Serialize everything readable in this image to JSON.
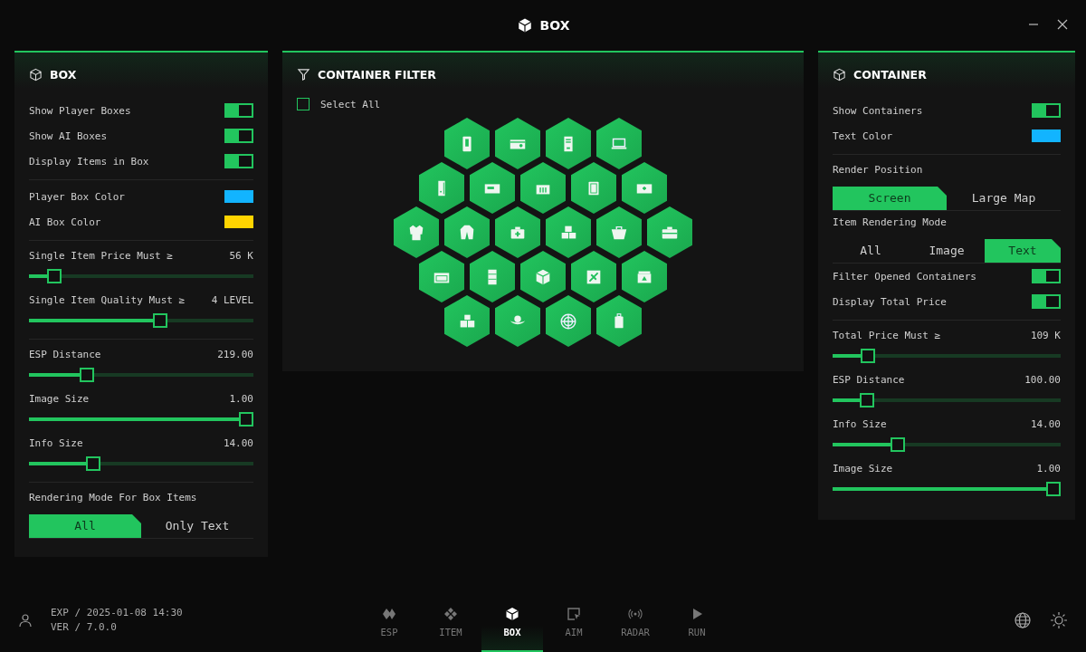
{
  "window": {
    "title": "BOX"
  },
  "left_panel": {
    "title": "BOX",
    "sections": [
      [
        {
          "kind": "toggle",
          "label": "Show Player Boxes",
          "on": true
        },
        {
          "kind": "toggle",
          "label": "Show AI Boxes",
          "on": true
        },
        {
          "kind": "toggle",
          "label": "Display Items in Box",
          "on": true
        }
      ],
      [
        {
          "kind": "color",
          "label": "Player Box Color",
          "color": "#12b4ff"
        },
        {
          "kind": "color",
          "label": "AI Box Color",
          "color": "#ffd400"
        }
      ],
      [
        {
          "kind": "slider",
          "label": "Single Item Price Must ≥",
          "value": "56 K",
          "level": 0.085
        },
        {
          "kind": "slider",
          "label": "Single Item Quality Must ≥",
          "value": "4 LEVEL",
          "level": 0.59
        }
      ],
      [
        {
          "kind": "slider",
          "label": "ESP Distance",
          "value": "219.00",
          "level": 0.24
        },
        {
          "kind": "slider",
          "label": "Image Size",
          "value": "1.00",
          "level": 1
        },
        {
          "kind": "slider",
          "label": "Info Size",
          "value": "14.00",
          "level": 0.27
        }
      ],
      [
        {
          "kind": "segment",
          "label": "Rendering Mode For Box Items",
          "options": [
            {
              "label": "All",
              "selected": true
            },
            {
              "label": "Only Text",
              "selected": false
            }
          ]
        }
      ]
    ]
  },
  "filter_panel": {
    "title": "CONTAINER FILTER",
    "select_all": {
      "label": "Select All",
      "checked": false
    },
    "container_rows": [
      [
        {
          "selected": true
        },
        {
          "selected": true
        },
        {
          "selected": true
        },
        {
          "selected": true
        }
      ],
      [
        {
          "selected": true
        },
        {
          "selected": true
        },
        {
          "selected": true
        },
        {
          "selected": true
        },
        {
          "selected": true
        }
      ],
      [
        {
          "selected": true
        },
        {
          "selected": true
        },
        {
          "selected": true
        },
        {
          "selected": true
        },
        {
          "selected": true
        },
        {
          "selected": true
        }
      ],
      [
        {
          "selected": true
        },
        {
          "selected": true
        },
        {
          "selected": true
        },
        {
          "selected": true
        },
        {
          "selected": true
        }
      ],
      [
        {
          "selected": true
        },
        {
          "selected": true
        },
        {
          "selected": true
        },
        {
          "selected": true
        }
      ]
    ]
  },
  "right_panel": {
    "title": "CONTAINER",
    "sections": [
      [
        {
          "kind": "toggle",
          "label": "Show Containers",
          "on": true
        },
        {
          "kind": "color",
          "label": "Text Color",
          "color": "#12b4ff"
        }
      ],
      [
        {
          "kind": "segment",
          "label": "Render Position",
          "options": [
            {
              "label": "Screen",
              "selected": true
            },
            {
              "label": "Large Map",
              "selected": false
            }
          ]
        },
        {
          "kind": "segment",
          "label": "Item Rendering Mode",
          "options": [
            {
              "label": "All",
              "selected": false
            },
            {
              "label": "Image",
              "selected": false
            },
            {
              "label": "Text",
              "selected": true
            }
          ]
        },
        {
          "kind": "toggle",
          "label": "Filter Opened Containers",
          "on": true
        },
        {
          "kind": "toggle",
          "label": "Display Total Price",
          "on": true
        }
      ],
      [
        {
          "kind": "slider",
          "label": "Total Price Must ≥",
          "value": "109 K",
          "level": 0.13
        },
        {
          "kind": "slider",
          "label": "ESP Distance",
          "value": "100.00",
          "level": 0.125
        },
        {
          "kind": "slider",
          "label": "Info Size",
          "value": "14.00",
          "level": 0.27
        },
        {
          "kind": "slider",
          "label": "Image Size",
          "value": "1.00",
          "level": 1
        }
      ]
    ]
  },
  "footer": {
    "exp": "EXP / 2025-01-08 14:30",
    "version": "VER / 7.0.0"
  },
  "nav_tabs": [
    {
      "label": "ESP",
      "selected": false
    },
    {
      "label": "ITEM",
      "selected": false
    },
    {
      "label": "BOX",
      "selected": true
    },
    {
      "label": "AIM",
      "selected": false
    },
    {
      "label": "RADAR",
      "selected": false
    },
    {
      "label": "RUN",
      "selected": false
    }
  ]
}
